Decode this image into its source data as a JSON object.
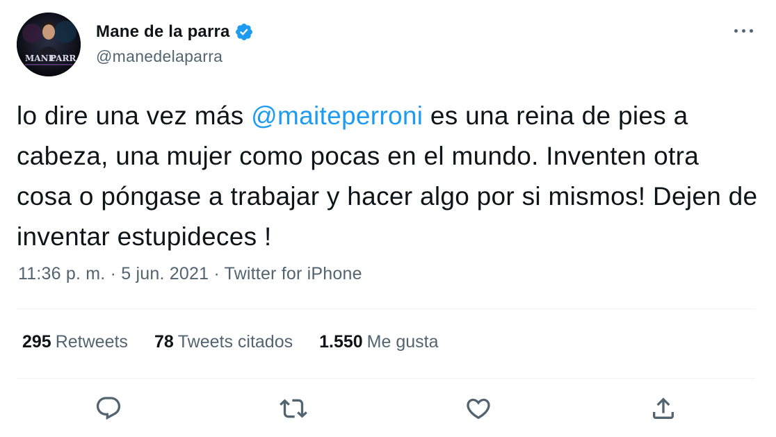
{
  "author": {
    "display_name": "Mane de la parra",
    "handle": "@manedelaparra",
    "verified_icon": "verified-badge-icon",
    "avatar_text_line1": "MANE",
    "avatar_text_line2": "PARRA"
  },
  "tweet": {
    "text_before_mention": "lo dire una vez más ",
    "mention": "@maiteperroni",
    "text_after_mention": " es una reina de pies a cabeza, una mujer como pocas en el mundo. Inventen otra cosa o póngase a trabajar y hacer algo por si mismos! Dejen de inventar estupideces !",
    "time": "11:36 p. m.",
    "separator": " · ",
    "date": "5 jun. 2021",
    "source": "Twitter for iPhone"
  },
  "stats": {
    "retweets_count": "295",
    "retweets_label": "Retweets",
    "quotes_count": "78",
    "quotes_label": "Tweets citados",
    "likes_count": "1.550",
    "likes_label": "Me gusta"
  },
  "actions": [
    "reply-icon",
    "retweet-icon",
    "like-icon",
    "share-icon"
  ],
  "colors": {
    "accent": "#1d9bf0",
    "text_primary": "#0f1419",
    "text_secondary": "#536471",
    "divider": "#eff3f4"
  }
}
